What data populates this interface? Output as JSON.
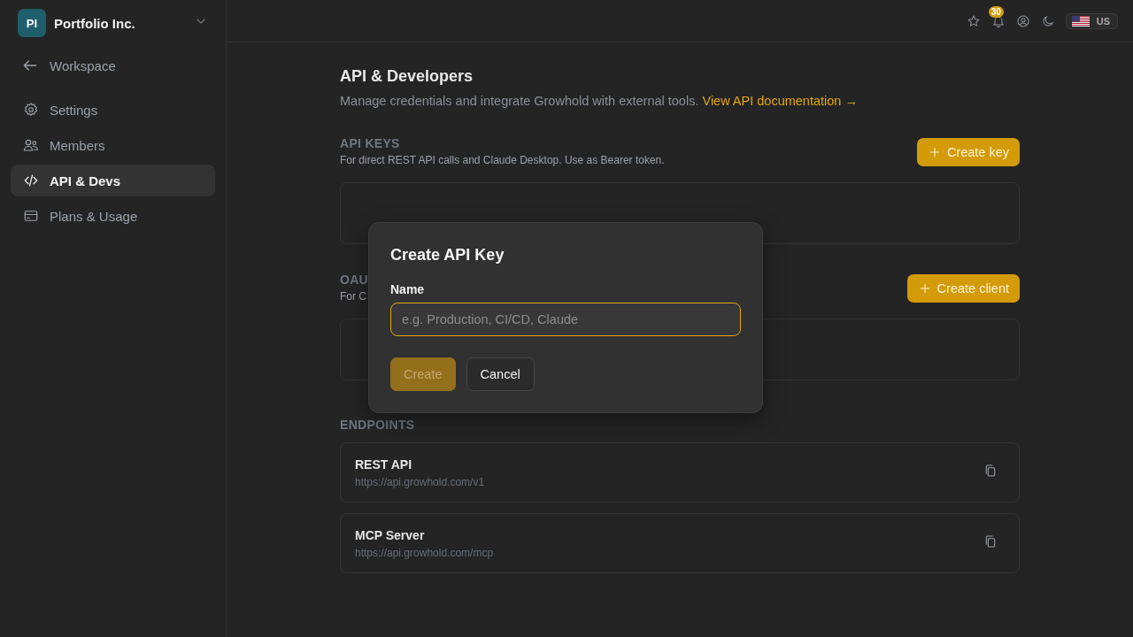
{
  "workspace": {
    "initials": "PI",
    "name": "Portfolio Inc."
  },
  "back_link": "Workspace",
  "nav": [
    {
      "label": "Settings",
      "kind": "settings",
      "selected": false
    },
    {
      "label": "Members",
      "kind": "members",
      "selected": false
    },
    {
      "label": "API & Devs",
      "kind": "code",
      "selected": true
    },
    {
      "label": "Plans & Usage",
      "kind": "card",
      "selected": false
    }
  ],
  "topbar": {
    "notification_count": "30",
    "locale": "US"
  },
  "page": {
    "title": "API & Developers",
    "subtitle": "Manage credentials and integrate Growhold with external tools.",
    "doc_link": "View API documentation →"
  },
  "sections": [
    {
      "title": "API KEYS",
      "description": "For direct REST API calls and Claude Desktop. Use as Bearer token.",
      "button": "Create key"
    },
    {
      "title": "OAU",
      "description": "For C",
      "button": "Create client"
    }
  ],
  "endpoints": {
    "title": "ENDPOINTS",
    "items": [
      {
        "name": "REST API",
        "url": "https://api.growhold.com/v1"
      },
      {
        "name": "MCP Server",
        "url": "https://api.growhold.com/mcp"
      }
    ]
  },
  "dialog": {
    "title": "Create API Key",
    "field_label": "Name",
    "placeholder": "e.g. Production, CI/CD, Claude",
    "buttons": [
      {
        "label": "Create",
        "kind": "primary",
        "disabled": true
      },
      {
        "label": "Cancel",
        "kind": "secondary",
        "disabled": false
      }
    ]
  }
}
